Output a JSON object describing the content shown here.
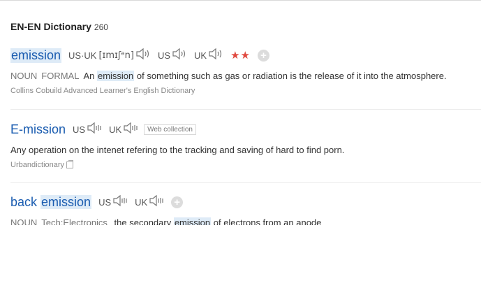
{
  "section": {
    "title": "EN-EN Dictionary",
    "count": "260"
  },
  "entries": [
    {
      "word": "emission",
      "pron": {
        "both_label": "US·UK",
        "phonetic": "[ɪmɪʃᵊn]",
        "us": "US",
        "uk": "UK"
      },
      "stars": "★★",
      "pos": "NOUN",
      "register": "FORMAL",
      "def_pre": "An ",
      "def_hl": "emission",
      "def_post": " of something such as gas or radiation is the release of it into the atmosphere.",
      "source": "Collins Cobuild Advanced Learner's English Dictionary"
    },
    {
      "word": "E-mission",
      "pron": {
        "us": "US",
        "uk": "UK"
      },
      "tag": "Web collection",
      "definition": "Any operation on the intenet refering to the tracking and saving of hard to find porn.",
      "source": "Urbandictionary"
    },
    {
      "word_pre": "back ",
      "word_hl": "emission",
      "pron": {
        "us": "US",
        "uk": "UK"
      },
      "pos": "NOUN",
      "domain": "Tech:Electronics",
      "def_pre": " the secondary ",
      "def_hl": "emission",
      "def_post": " of electrons from an anode"
    }
  ],
  "icons": {
    "speaker": "speaker-icon",
    "add": "plus-circle-icon",
    "copy": "copy-icon"
  },
  "colors": {
    "link": "#1a5cb0",
    "highlight": "#deebf7",
    "star": "#e0493f"
  }
}
